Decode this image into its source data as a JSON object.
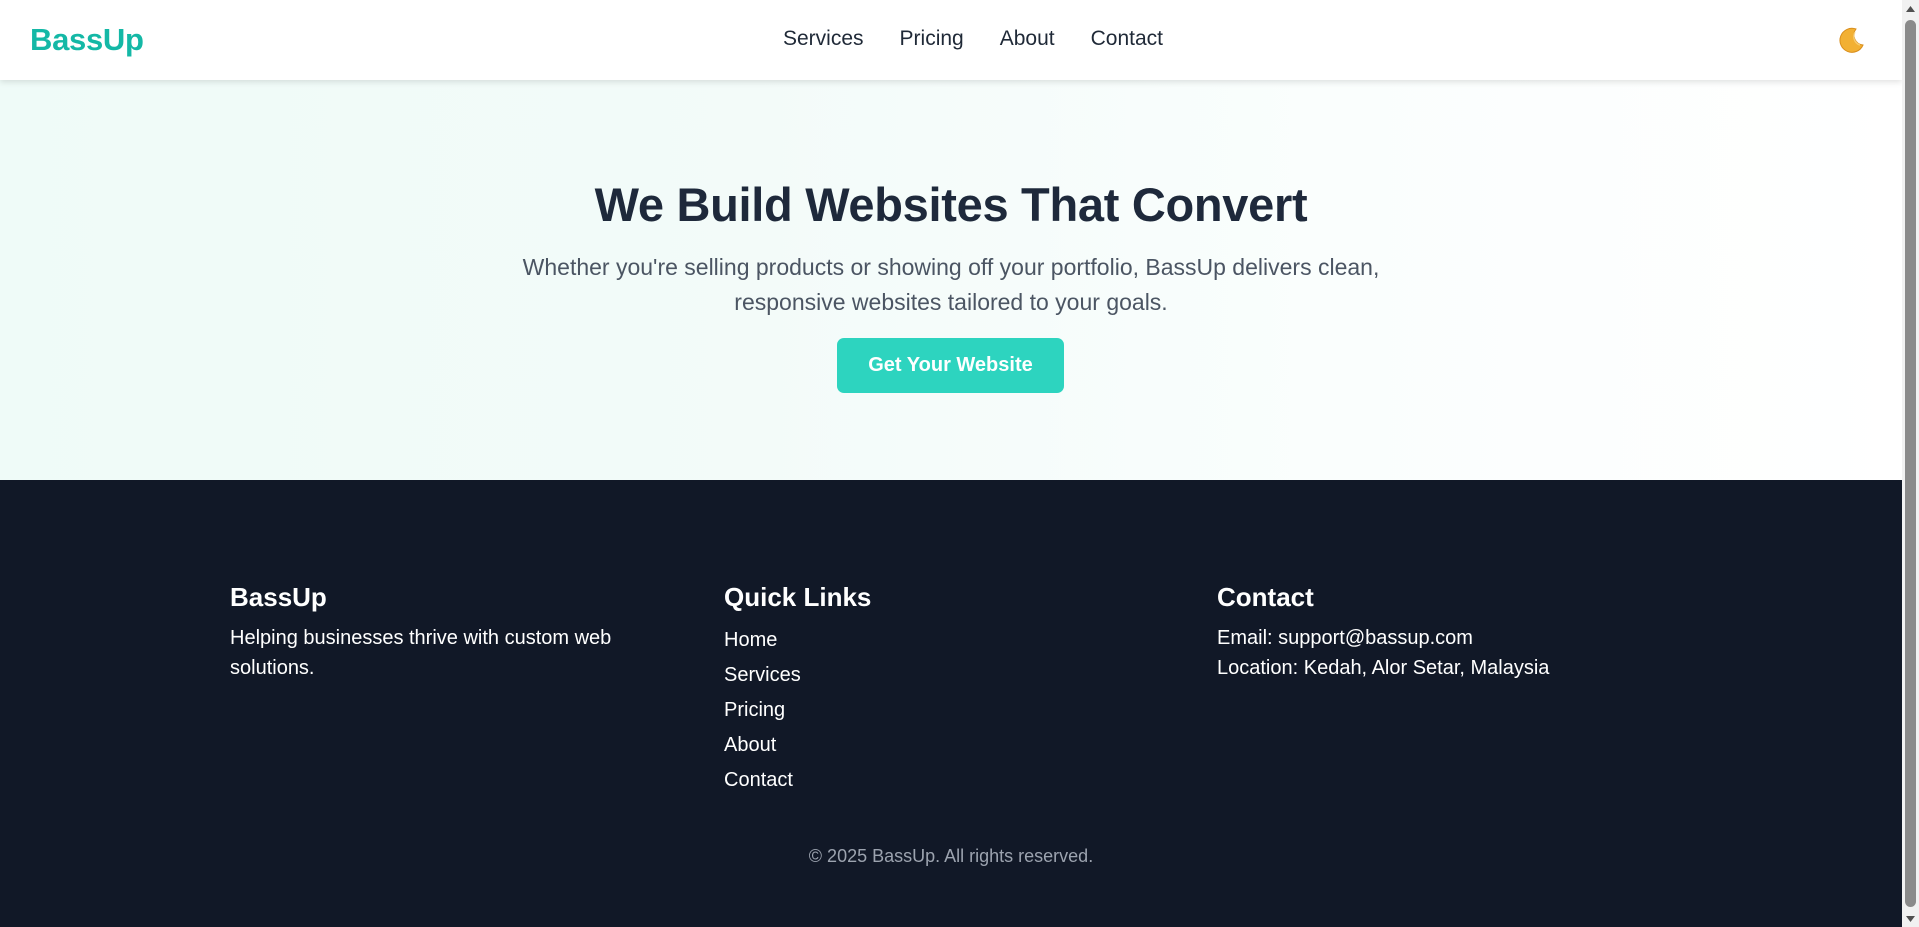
{
  "header": {
    "logo": "BassUp",
    "nav": [
      "Services",
      "Pricing",
      "About",
      "Contact"
    ],
    "theme_icon": "moon-icon"
  },
  "hero": {
    "title": "We Build Websites That Convert",
    "subtitle": "Whether you're selling products or showing off your portfolio, BassUp delivers clean, responsive websites tailored to your goals.",
    "cta_label": "Get Your Website"
  },
  "footer": {
    "brand": {
      "title": "BassUp",
      "text": "Helping businesses thrive with custom web solutions."
    },
    "quick_links": {
      "title": "Quick Links",
      "links": [
        "Home",
        "Services",
        "Pricing",
        "About",
        "Contact"
      ]
    },
    "contact": {
      "title": "Contact",
      "email": "Email: support@bassup.com",
      "location": "Location: Kedah, Alor Setar, Malaysia"
    },
    "copyright": "© 2025 BassUp. All rights reserved."
  },
  "colors": {
    "brand": "#14b8a6",
    "cta": "#2dd4bf",
    "footer_bg": "#111827",
    "heading": "#1e293b"
  }
}
